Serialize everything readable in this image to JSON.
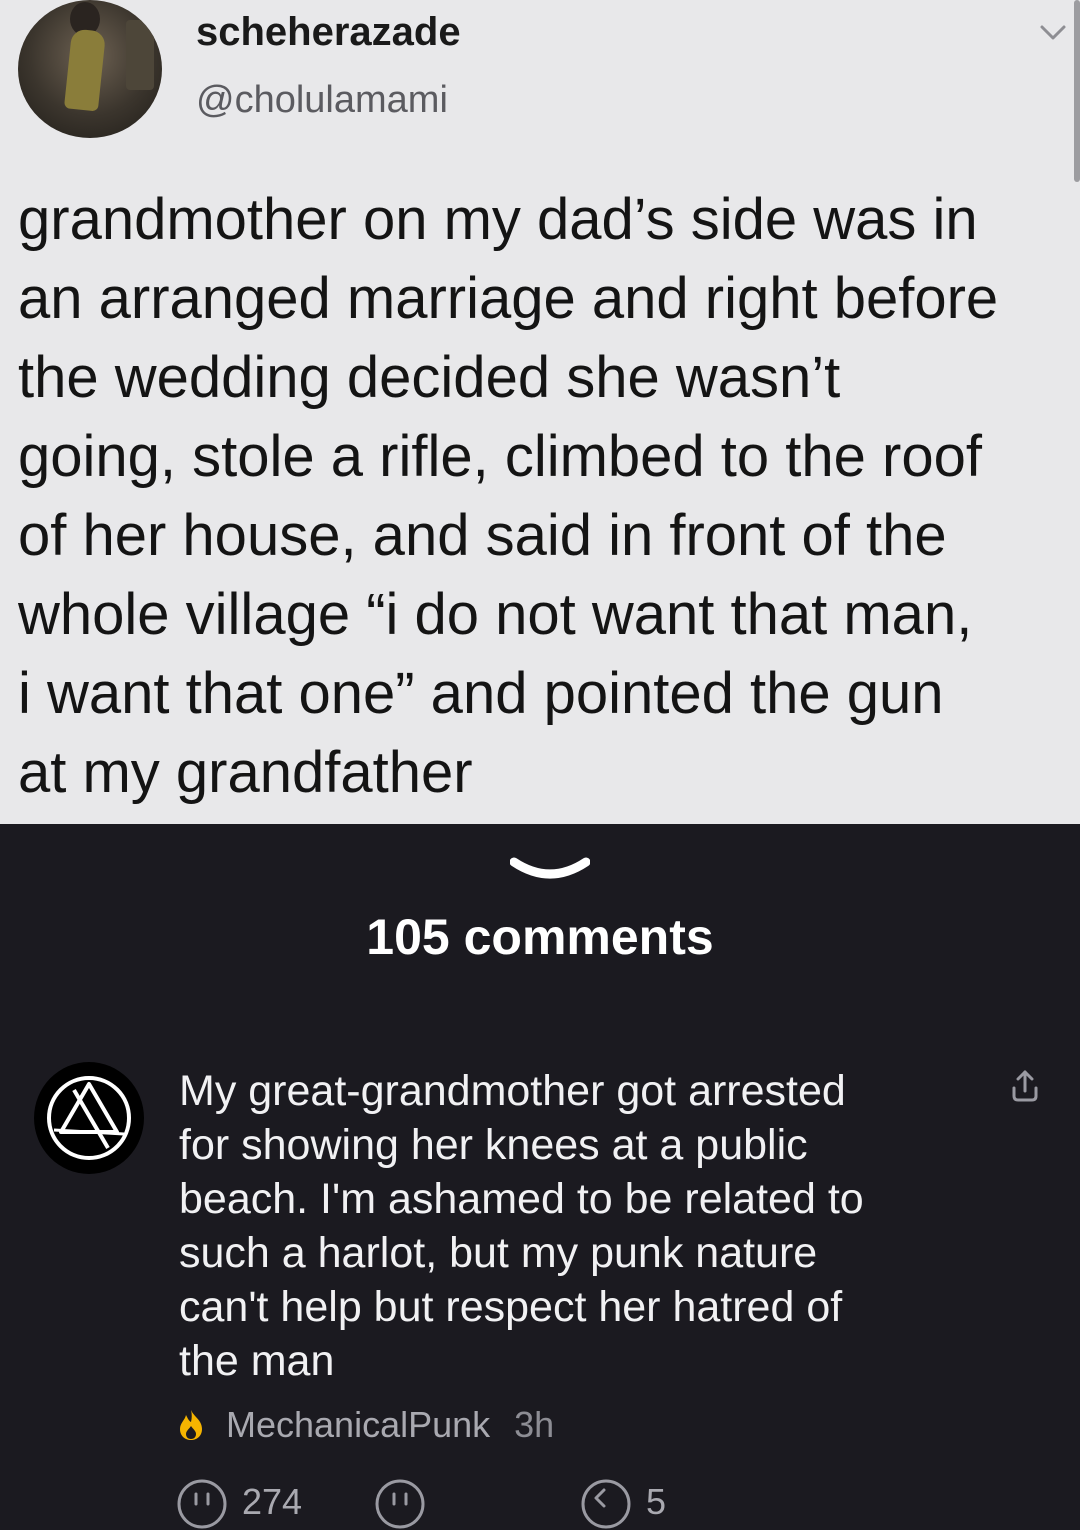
{
  "tweet": {
    "display_name": "scheherazade",
    "handle": "@cholulamami",
    "text_lines": [
      "grandmother on my dad’s side was in",
      "an arranged marriage and right before",
      "the wedding decided she wasn’t",
      "going, stole a rifle, climbed to the roof",
      "of her house, and said in front of the",
      "whole village “i do not want that man,",
      "i want that one” and pointed the gun",
      "at my grandfather"
    ]
  },
  "comments_section": {
    "count_label": "105 comments"
  },
  "comment": {
    "text_lines": [
      "My great-grandmother got arrested",
      "for showing her knees at a public",
      "beach. I'm ashamed to be related to",
      "such a harlot, but my punk nature",
      "can't help but respect her hatred of",
      "the man"
    ],
    "author": "MechanicalPunk",
    "time": "3h",
    "upvotes": "274",
    "replies": "5"
  },
  "colors": {
    "tweet_background": "#e8e8ea",
    "app_background": "#1b1a20",
    "flame_accent": "#f5b400"
  },
  "icons": {
    "drawer_handle": "chevron-down-icon",
    "share": "share-icon",
    "flame": "flame-icon",
    "upvote": "upvote-icon",
    "downvote": "downvote-icon",
    "reply": "reply-icon"
  }
}
